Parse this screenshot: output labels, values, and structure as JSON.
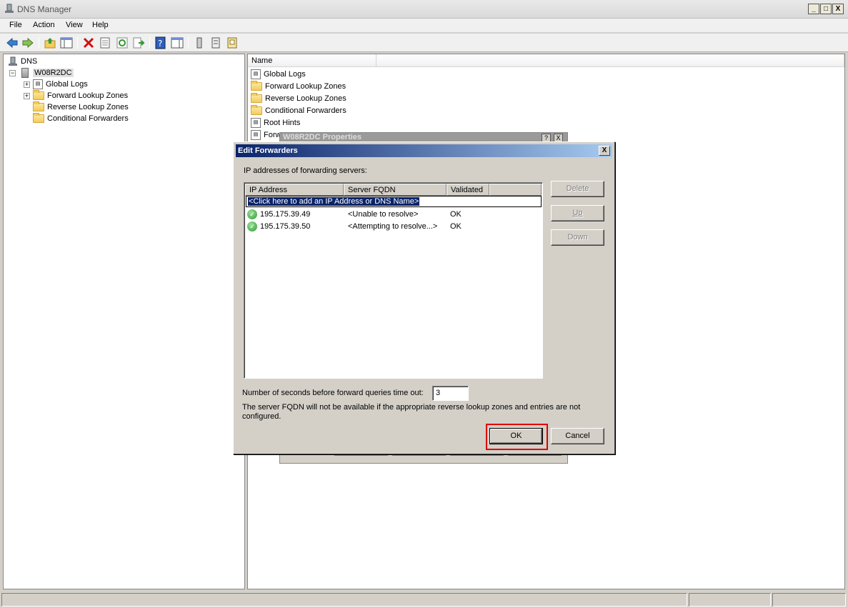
{
  "window": {
    "title": "DNS Manager",
    "minimize": "_",
    "maximize": "□",
    "close": "X"
  },
  "menu": [
    "File",
    "Action",
    "View",
    "Help"
  ],
  "tree": {
    "root": "DNS",
    "server": "W08R2DC",
    "children": [
      "Global Logs",
      "Forward Lookup Zones",
      "Reverse Lookup Zones",
      "Conditional Forwarders"
    ]
  },
  "list": {
    "column": "Name",
    "items": [
      "Global Logs",
      "Forward Lookup Zones",
      "Reverse Lookup Zones",
      "Conditional Forwarders",
      "Root Hints",
      "Forw"
    ]
  },
  "props_dialog": {
    "title": "W08R2DC Properties",
    "help": "?",
    "close": "X"
  },
  "edit_forwarders": {
    "title": "Edit Forwarders",
    "close": "X",
    "section_label": "IP addresses of forwarding servers:",
    "columns": [
      "IP Address",
      "Server FQDN",
      "Validated"
    ],
    "add_placeholder": "<Click here to add an IP Address or DNS Name>",
    "rows": [
      {
        "ip": "195.175.39.49",
        "fqdn": "<Unable to resolve>",
        "validated": "OK"
      },
      {
        "ip": "195.175.39.50",
        "fqdn": "<Attempting to resolve...>",
        "validated": "OK"
      }
    ],
    "buttons": {
      "delete": "Delete",
      "up": "Up",
      "down": "Down",
      "ok": "OK",
      "cancel": "Cancel"
    },
    "timeout_label": "Number of seconds before forward queries time out:",
    "timeout_value": "3",
    "note_line1": "The server FQDN will not be available if the appropriate reverse lookup zones and entries are not",
    "note_line2": "configured."
  },
  "colors": {
    "title_active": "#0a246a",
    "highlight_box": "#e00000",
    "check_green": "#2e9a2e"
  }
}
